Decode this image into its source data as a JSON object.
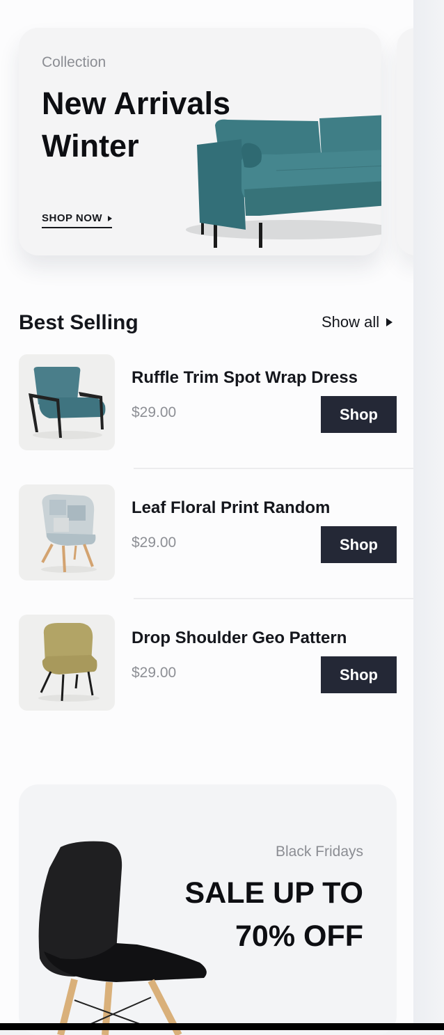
{
  "hero": {
    "eyebrow": "Collection",
    "title": "New Arrivals Winter",
    "cta": "SHOP NOW",
    "image": "teal-sofa"
  },
  "best_selling": {
    "title": "Best Selling",
    "show_all": "Show all",
    "items": [
      {
        "name": "Ruffle Trim Spot Wrap Dress",
        "price": "$29.00",
        "button": "Shop",
        "image": "teal-armchair"
      },
      {
        "name": "Leaf Floral Print Random",
        "price": "$29.00",
        "button": "Shop",
        "image": "patchwork-chair"
      },
      {
        "name": "Drop Shoulder Geo Pattern",
        "price": "$29.00",
        "button": "Shop",
        "image": "olive-armchair"
      }
    ]
  },
  "promo": {
    "eyebrow": "Black Fridays",
    "title": "SALE UP TO 70% OFF",
    "image": "black-chair"
  },
  "colors": {
    "accent_button": "#242836",
    "background": "#fcfcfd",
    "card": "#f4f4f5",
    "muted_text": "#8d8f95"
  }
}
